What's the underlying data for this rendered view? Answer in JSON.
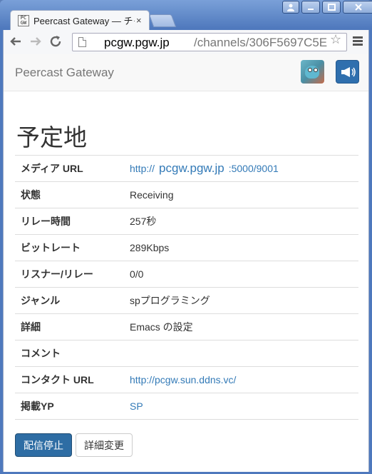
{
  "browser": {
    "tab_title": "Peercast Gateway — チャンネル",
    "tab_close": "×",
    "url_host": "pcgw.pgw.jp",
    "url_path": "/channels/306F5697C5E",
    "star": "☆"
  },
  "navbar": {
    "brand": "Peercast Gateway"
  },
  "channel": {
    "title": "予定地",
    "rows": [
      {
        "key": "メディア URL",
        "prefix": "http://",
        "host": "pcgw.pgw.jp",
        "suffix": ":5000/9001"
      },
      {
        "key": "状態",
        "value": "Receiving"
      },
      {
        "key": "リレー時間",
        "value": "257秒"
      },
      {
        "key": "ビットレート",
        "value": "289Kbps"
      },
      {
        "key": "リスナー/リレー",
        "value": "0/0"
      },
      {
        "key": "ジャンル",
        "value": "spプログラミング"
      },
      {
        "key": "詳細",
        "value": "Emacs の設定"
      },
      {
        "key": "コメント",
        "value": ""
      },
      {
        "key": "コンタクト URL",
        "link": "http://pcgw.sun.ddns.vc/"
      },
      {
        "key": "掲載YP",
        "link": "SP"
      }
    ]
  },
  "actions": {
    "stop": "配信停止",
    "edit": "詳細変更"
  },
  "colors": {
    "primary": "#2e6da4",
    "link": "#337ab7"
  }
}
